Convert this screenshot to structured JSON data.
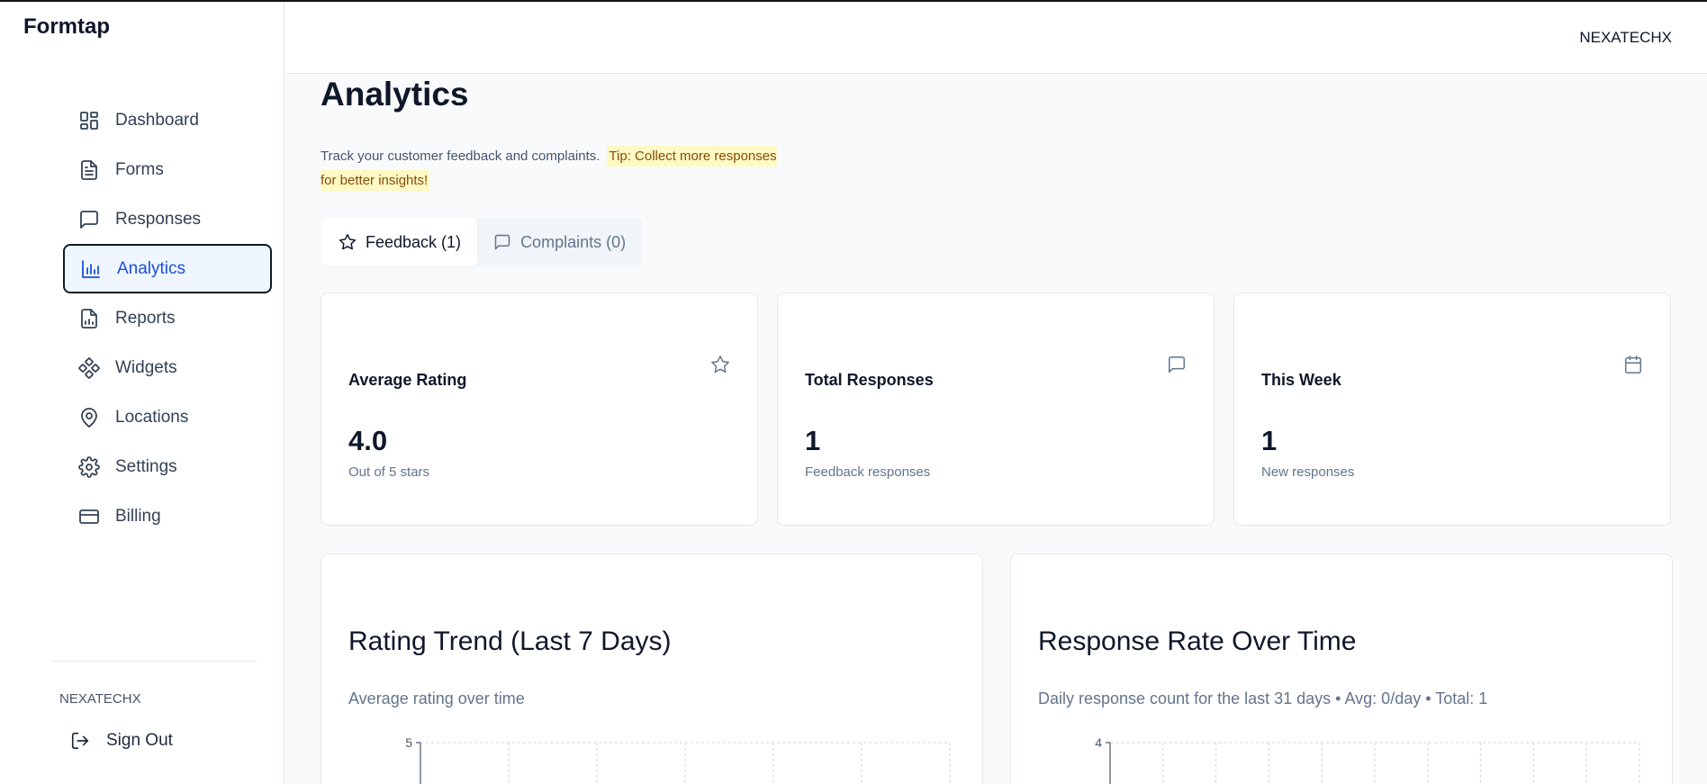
{
  "app": {
    "name": "Formtap"
  },
  "sidebar": {
    "items": [
      {
        "label": "Dashboard",
        "icon": "dashboard-icon",
        "active": false
      },
      {
        "label": "Forms",
        "icon": "file-text-icon",
        "active": false
      },
      {
        "label": "Responses",
        "icon": "message-square-icon",
        "active": false
      },
      {
        "label": "Analytics",
        "icon": "bar-chart-icon",
        "active": true
      },
      {
        "label": "Reports",
        "icon": "file-chart-icon",
        "active": false
      },
      {
        "label": "Widgets",
        "icon": "widgets-icon",
        "active": false
      },
      {
        "label": "Locations",
        "icon": "map-pin-icon",
        "active": false
      },
      {
        "label": "Settings",
        "icon": "gear-icon",
        "active": false
      },
      {
        "label": "Billing",
        "icon": "credit-card-icon",
        "active": false
      }
    ],
    "user": "NEXATECHX",
    "sign_out": "Sign Out"
  },
  "header": {
    "user": "NEXATECHX"
  },
  "main": {
    "title": "Analytics",
    "subtitle": "Track your customer feedback and complaints.",
    "tip": "Tip: Collect more responses for better insights!",
    "tabs": [
      {
        "label": "Feedback (1)",
        "icon": "star-icon",
        "active": true
      },
      {
        "label": "Complaints (0)",
        "icon": "message-square-icon",
        "active": false
      }
    ],
    "stats": [
      {
        "label": "Average Rating",
        "value": "4.0",
        "sub": "Out of 5 stars",
        "icon": "star-icon"
      },
      {
        "label": "Total Responses",
        "value": "1",
        "sub": "Feedback responses",
        "icon": "message-square-icon"
      },
      {
        "label": "This Week",
        "value": "1",
        "sub": "New responses",
        "icon": "calendar-icon"
      }
    ]
  },
  "colors": {
    "accent": "#1d4ed8",
    "tip_bg": "#fef9c3",
    "tip_text": "#854d0e",
    "muted": "#64748b"
  },
  "chart_data": [
    {
      "type": "line",
      "title": "Rating Trend (Last 7 Days)",
      "subtitle": "Average rating over time",
      "xlabel": "",
      "ylabel": "",
      "ylim": [
        0,
        5
      ],
      "y_ticks_visible": [
        "5"
      ],
      "grid": true,
      "series": []
    },
    {
      "type": "bar",
      "title": "Response Rate Over Time",
      "subtitle": "Daily response count for the last 31 days • Avg: 0/day • Total: 1",
      "xlabel": "",
      "ylabel": "",
      "ylim": [
        0,
        4
      ],
      "y_ticks_visible": [
        "4"
      ],
      "grid": true,
      "series": []
    }
  ]
}
